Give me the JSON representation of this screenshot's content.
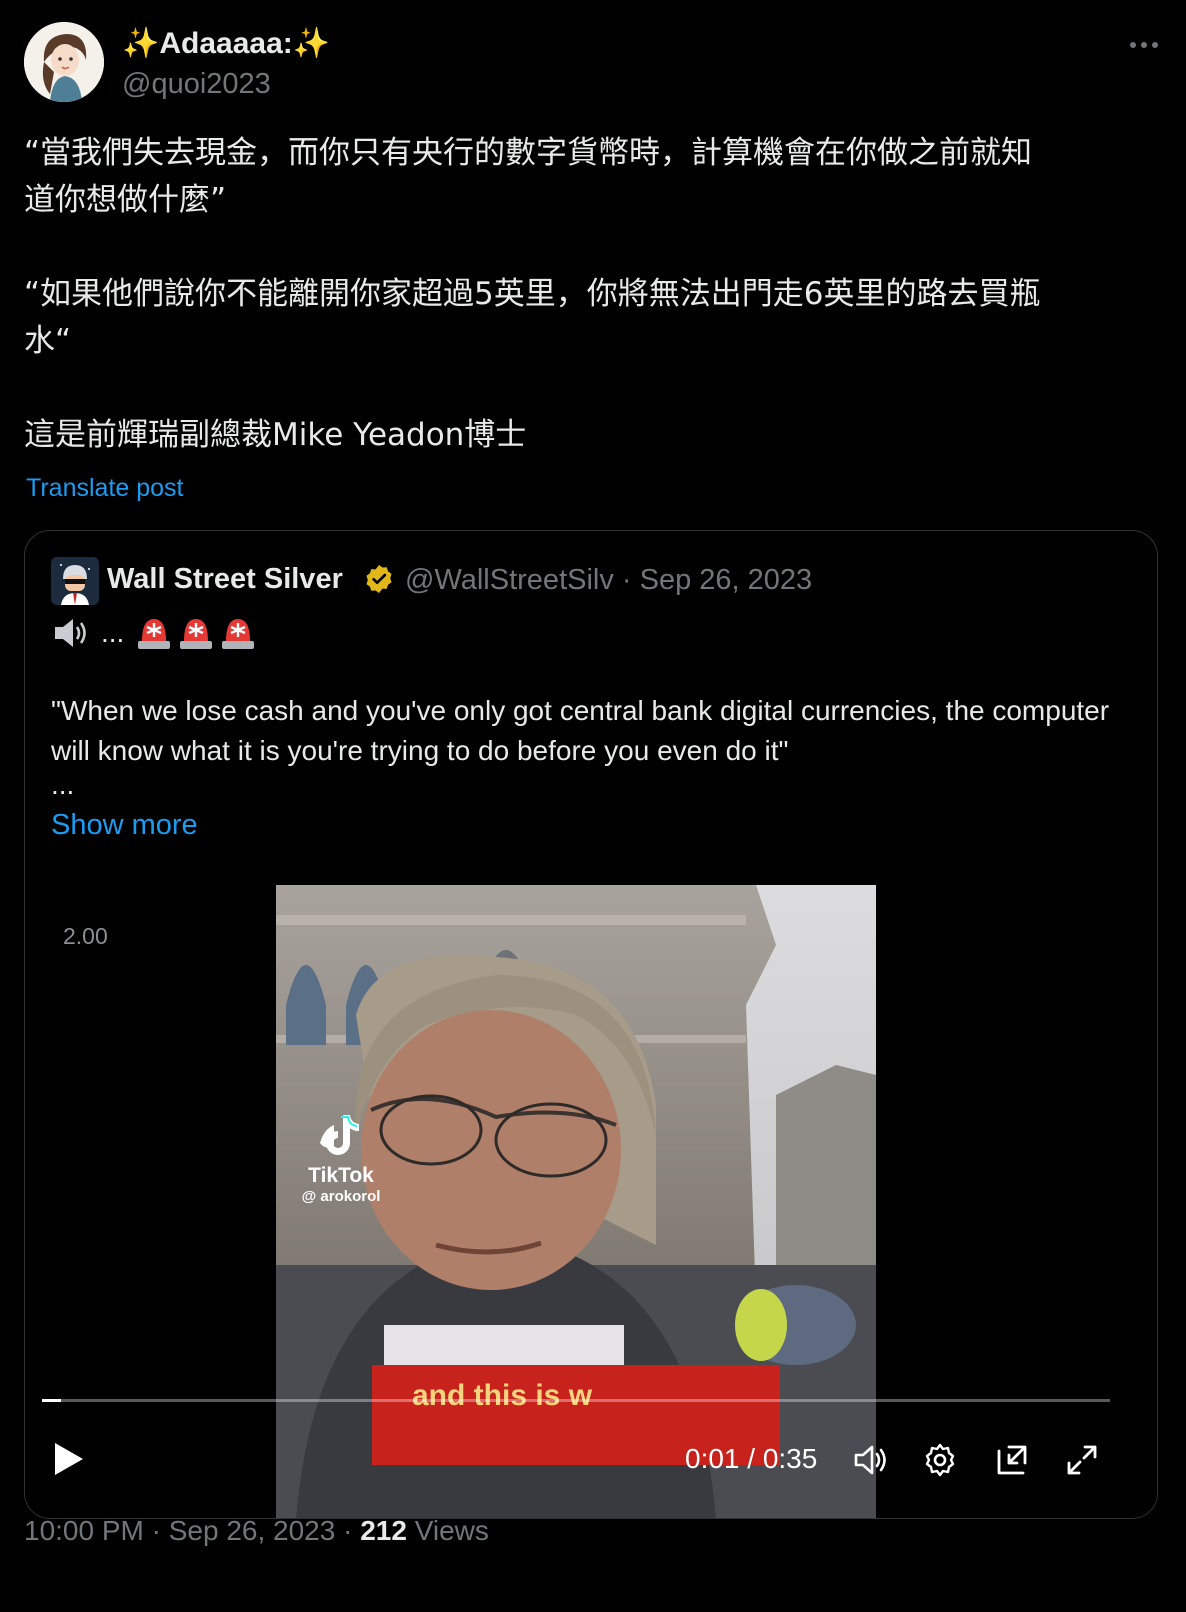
{
  "post": {
    "author_name": "✨Adaaaaa:✨",
    "author_handle": "@quoi2023",
    "text": [
      "“當我們失去現金，而你只有央行的數字貨幣時，計算機會在你做之前就知",
      "道你想做什麼”",
      "“如果他們說你不能離開你家超過5英里，你將無法出門走6英里的路去買瓶",
      "水“",
      "這是前輝瑞副總裁Mike Yeadon博士"
    ],
    "translate_label": "Translate post"
  },
  "quote": {
    "author_name": "Wall Street Silver",
    "author_handle": "@WallStreetSilv · Sep 26, 2023",
    "line1_dots": "...",
    "body": "\"When we lose cash and you've only got central bank digital currencies, the computer will know what it is you're trying to do before you even do it\"",
    "ellipsis": "...",
    "show_more": "Show more"
  },
  "video": {
    "overlay_label": "2.00",
    "tiktok_brand": "TikTok",
    "tiktok_user": "@ arokorol",
    "subtitle": "and this is w",
    "time": "0:01 / 0:35",
    "progress": 0.018
  },
  "footer": {
    "time": "10:00 PM · Sep 26, 2023 · ",
    "views_count": "212",
    "views_label": " Views"
  },
  "icons": [
    "more-icon",
    "verified-badge-icon",
    "speaker-icon",
    "siren-icon",
    "tiktok-icon",
    "play-icon",
    "volume-icon",
    "settings-icon",
    "pip-icon",
    "fullscreen-icon"
  ],
  "colors": {
    "link": "#1d9bf0",
    "secondary": "#71767b",
    "verified": "#e2b719",
    "subtitle_bg": "#c7221c"
  }
}
